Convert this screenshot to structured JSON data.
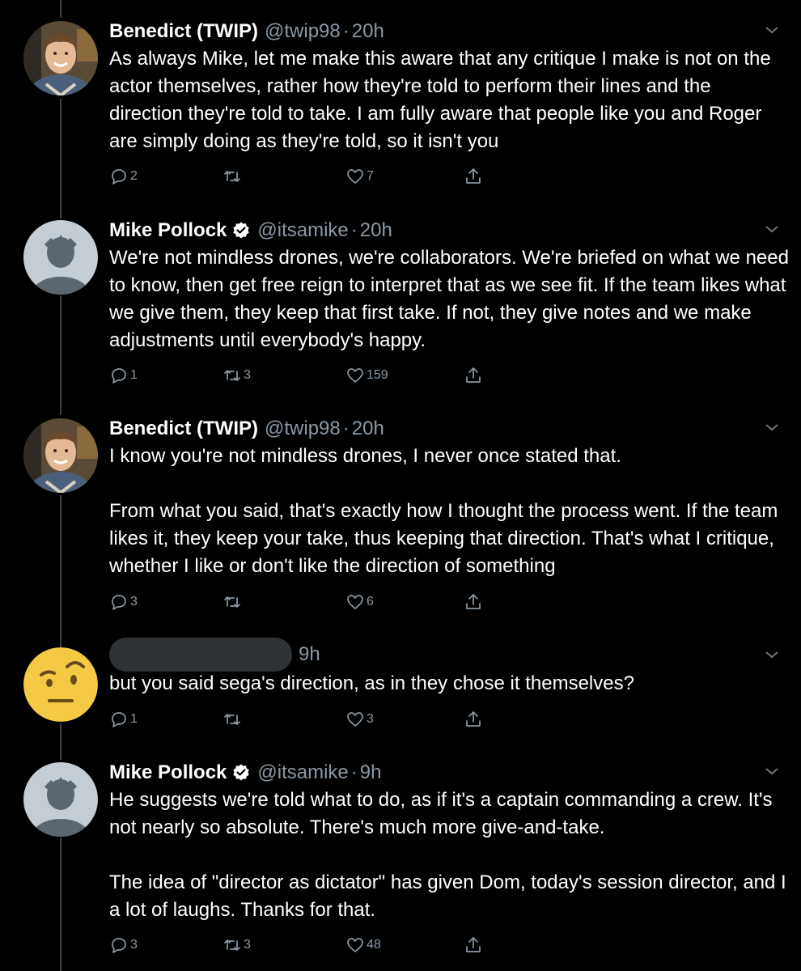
{
  "tweets": [
    {
      "name": "Benedict (TWIP)",
      "handle": "@twip98",
      "time": "20h",
      "text": "As always Mike, let me make this aware that any critique I make is not on the actor themselves, rather how they're told to perform their lines and the direction they're told to take. I am fully aware that people like you and Roger are simply doing as they're told, so it isn't you",
      "replies": "2",
      "retweets": "",
      "likes": "7",
      "avatar": "photo-avatar"
    },
    {
      "name": "Mike Pollock",
      "handle": "@itsamike",
      "time": "20h",
      "verified": "verified-badge-icon",
      "text": "We're not mindless drones, we're collaborators. We're briefed on what we need to know, then get free reign to interpret that as we see fit. If the team likes what we give them, they keep that first take. If not, they give notes and we make adjustments until everybody's happy.",
      "replies": "1",
      "retweets": "3",
      "likes": "159",
      "avatar": "default-avatar"
    },
    {
      "name": "Benedict (TWIP)",
      "handle": "@twip98",
      "time": "20h",
      "text": "I know you're not mindless drones, I never once stated that.\n\nFrom what you said, that's exactly how I thought the process went. If the team likes it, they keep your take, thus keeping that direction. That's what I critique, whether I like or don't like the direction of something",
      "replies": "3",
      "retweets": "",
      "likes": "6",
      "avatar": "photo-avatar"
    },
    {
      "time": "9h",
      "text": "but you said sega's direction, as in they chose it themselves?",
      "replies": "1",
      "retweets": "",
      "likes": "3",
      "avatar": "raised-eyebrow-emoji-avatar"
    },
    {
      "name": "Mike Pollock",
      "handle": "@itsamike",
      "time": "9h",
      "verified": "verified-badge-icon",
      "text": "He suggests we're told what to do, as if it's a captain commanding a crew. It's not nearly so absolute. There's much more give-and-take.\n\nThe idea of \"director as dictator\" has given Dom, today's session director, and I a lot of laughs. Thanks for that.",
      "replies": "3",
      "retweets": "3",
      "likes": "48",
      "avatar": "default-avatar"
    }
  ],
  "colors": {
    "background": "#000000",
    "text": "#ffffff",
    "secondary": "#8b98a5",
    "thread_line": "#3d4145",
    "default_avatar_bg": "#c4ccd4",
    "default_avatar_fg": "#5b6770",
    "emoji_yellow": "#f6c944"
  },
  "icons": [
    "reply-icon",
    "retweet-icon",
    "like-icon",
    "share-icon",
    "chevron-down-icon",
    "verified-badge-icon"
  ]
}
